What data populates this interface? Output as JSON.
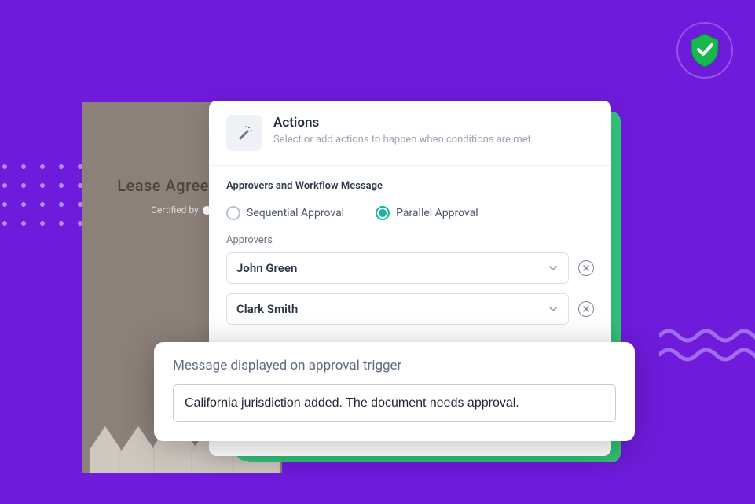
{
  "shield": {
    "icon_name": "shield-check-icon"
  },
  "doc": {
    "title": "Lease Agreement",
    "certified_prefix": "Certified by"
  },
  "card": {
    "title": "Actions",
    "subtitle": "Select or add actions to happen when conditions are met",
    "section_label": "Approvers and Workflow Message",
    "approval_types": {
      "sequential": "Sequential Approval",
      "parallel": "Parallel Approval",
      "selected": "parallel"
    },
    "approvers_label": "Approvers",
    "approvers": [
      "John Green",
      "Clark Smith"
    ]
  },
  "message": {
    "label": "Message displayed on approval trigger",
    "value": "California jurisdiction added. The document needs approval."
  }
}
